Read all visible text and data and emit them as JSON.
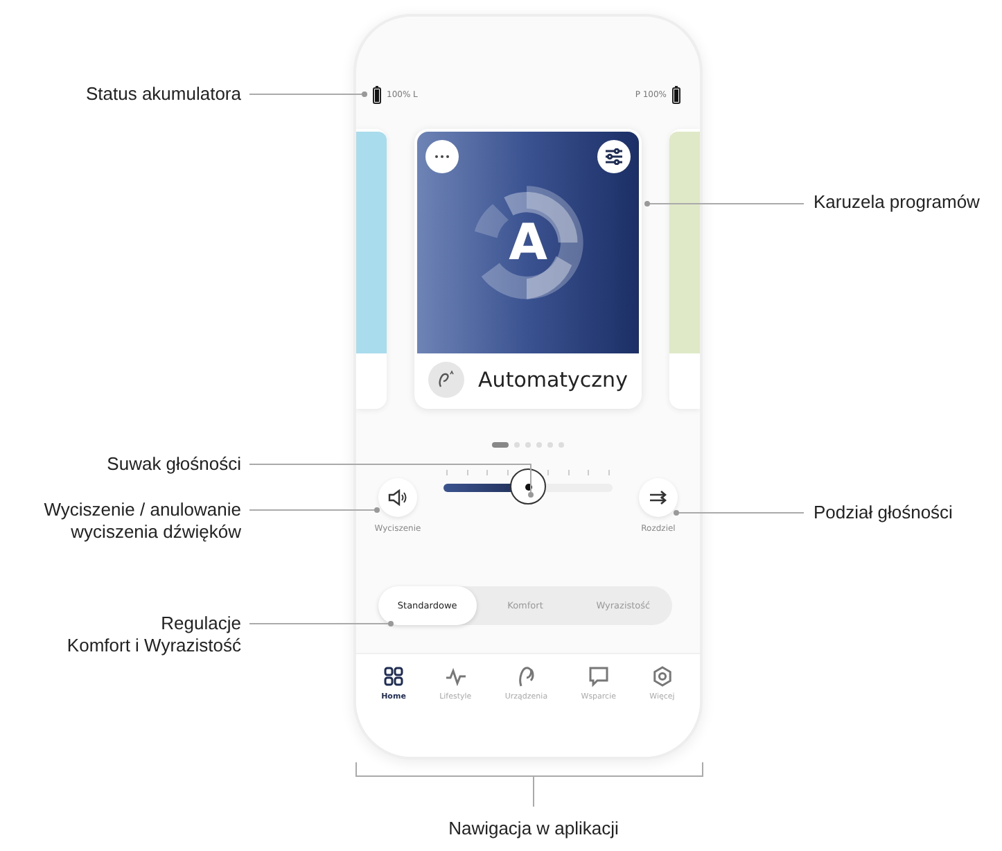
{
  "battery": {
    "left": "100% L",
    "right": "P 100%"
  },
  "program": {
    "name": "Automatyczny",
    "letter": "A"
  },
  "carousel_dots": [
    {
      "selected": true
    },
    {
      "selected": false
    },
    {
      "selected": false
    },
    {
      "selected": false
    },
    {
      "selected": false
    },
    {
      "selected": false
    }
  ],
  "volume": {
    "mute_label": "Wyciszenie",
    "split_label": "Rozdziel",
    "level": 0.5
  },
  "segments": [
    {
      "label": "Standardowe",
      "selected": true
    },
    {
      "label": "Komfort",
      "selected": false
    },
    {
      "label": "Wyrazistość",
      "selected": false
    }
  ],
  "nav": [
    {
      "label": "Home",
      "kind": "home",
      "selected": true
    },
    {
      "label": "Lifestyle",
      "kind": "lifestyle",
      "selected": false
    },
    {
      "label": "Urządzenia",
      "kind": "devices",
      "selected": false
    },
    {
      "label": "Wsparcie",
      "kind": "support",
      "selected": false
    },
    {
      "label": "Więcej",
      "kind": "more",
      "selected": false
    }
  ],
  "callouts": [
    {
      "kind": "left",
      "lines": [
        "Status akumulatora"
      ]
    },
    {
      "kind": "right",
      "lines": [
        "Karuzela programów"
      ]
    },
    {
      "kind": "left",
      "lines": [
        "Suwak głośności"
      ]
    },
    {
      "kind": "left",
      "lines": [
        "Wyciszenie / anulowanie",
        "wyciszenia dźwięków"
      ]
    },
    {
      "kind": "right",
      "lines": [
        "Podział głośności"
      ]
    },
    {
      "kind": "left",
      "lines": [
        "Regulacje",
        "Komfort i Wyrazistość"
      ]
    },
    {
      "kind": "bottom",
      "lines": [
        "Nawigacja w aplikacji"
      ]
    }
  ]
}
